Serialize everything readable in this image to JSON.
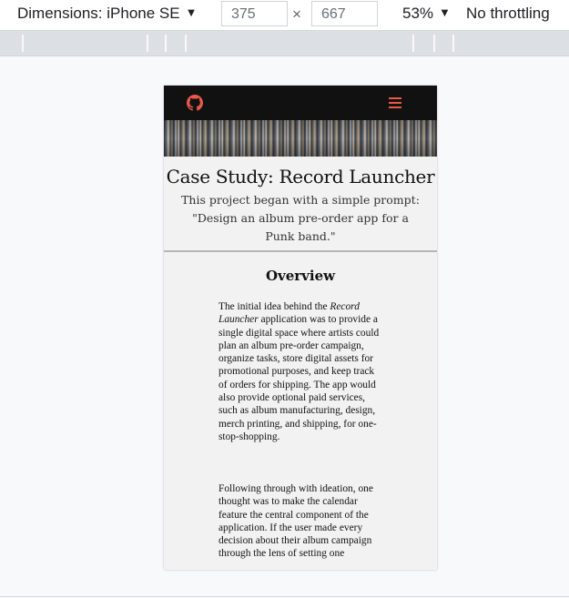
{
  "toolbar": {
    "dimensions_label": "Dimensions: iPhone SE",
    "width_value": "375",
    "times_symbol": "×",
    "height_value": "667",
    "zoom_label": "53%",
    "throttling_label": "No throttling",
    "dropdown_arrow": "▼"
  },
  "page": {
    "nav": {
      "github_icon": "github-icon",
      "menu_icon": "hamburger-menu-icon",
      "accent_color": "#e8594a"
    },
    "title": "Case Study: Record Launcher",
    "intro": "This project began with a simple prompt: \"Design an album pre-order app for a Punk band.\"",
    "overview_heading": "Overview",
    "p1_before": "The initial idea behind the ",
    "p1_italic": "Record Launcher",
    "p1_after": " application was to provide a single digital space where artists could plan an album pre-order campaign, organize tasks, store digital assets for promotional purposes, and keep track of orders for shipping. The app would also provide optional paid services, such as album manufacturing, design, merch printing, and shipping, for one-stop-shopping.",
    "p2": "Following through with ideation, one thought was to make the calendar feature the central component of the application. If the user made every decision about their album campaign through the lens of setting one"
  }
}
